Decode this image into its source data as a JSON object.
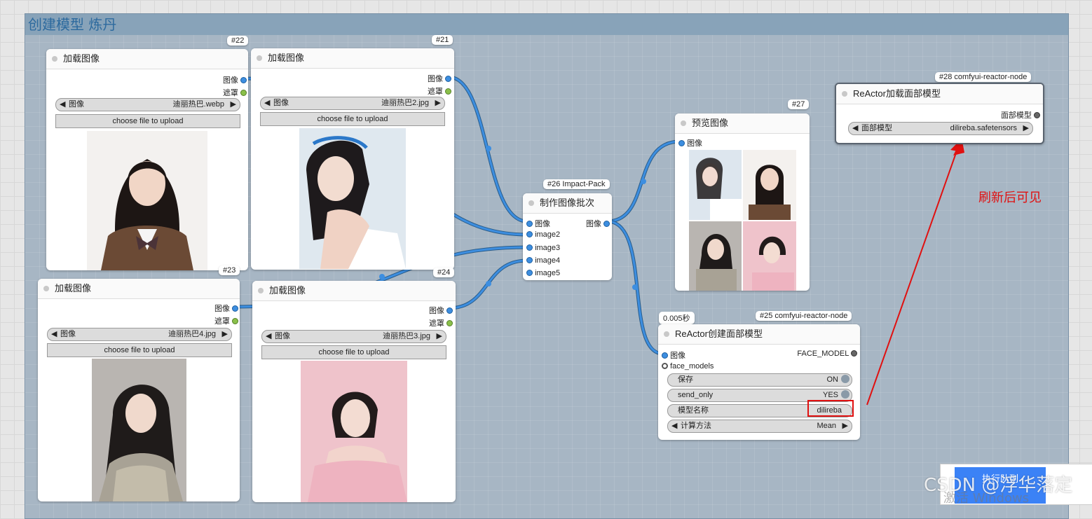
{
  "group": {
    "title": "创建模型  炼丹"
  },
  "load_nodes": [
    {
      "id": "#22",
      "title": "加载图像",
      "out_image": "图像",
      "out_mask": "遮罩",
      "combo_label": "图像",
      "combo_value": "迪丽热巴.webp",
      "upload": "choose file to upload"
    },
    {
      "id": "#21",
      "title": "加载图像",
      "out_image": "图像",
      "out_mask": "遮罩",
      "combo_label": "图像",
      "combo_value": "迪丽热巴2.jpg",
      "upload": "choose file to upload"
    },
    {
      "id": "#23",
      "title": "加载图像",
      "out_image": "图像",
      "out_mask": "遮罩",
      "combo_label": "图像",
      "combo_value": "迪丽热巴4.jpg",
      "upload": "choose file to upload"
    },
    {
      "id": "#24",
      "title": "加载图像",
      "out_image": "图像",
      "out_mask": "遮罩",
      "combo_label": "图像",
      "combo_value": "迪丽热巴3.jpg",
      "upload": "choose file to upload"
    }
  ],
  "batch_node": {
    "id": "#26 Impact-Pack",
    "title": "制作图像批次",
    "inputs": [
      "图像",
      "image2",
      "image3",
      "image4",
      "image5"
    ],
    "output": "图像"
  },
  "preview_node": {
    "id": "#27",
    "title": "预览图像",
    "input": "图像"
  },
  "create_node": {
    "id": "#25 comfyui-reactor-node",
    "time": "0.005秒",
    "title": "ReActor创建面部模型",
    "input_image": "图像",
    "input_face_models": "face_models",
    "output": "FACE_MODEL",
    "save_label": "保存",
    "save_value": "ON",
    "send_only_label": "send_only",
    "send_only_value": "YES",
    "name_label": "模型名称",
    "name_value": "dilireba",
    "method_label": "计算方法",
    "method_value": "Mean"
  },
  "load_face_node": {
    "id": "#28 comfyui-reactor-node",
    "title": "ReActor加载面部模型",
    "output": "面部模型",
    "combo_label": "面部模型",
    "combo_value": "dilireba.safetensors"
  },
  "annotation": {
    "text": "刷新后可见"
  },
  "queue_button": {
    "label": "执行队列"
  },
  "watermark": {
    "csdn": "CSDN @浮华落定",
    "windows": "激活 Windows"
  },
  "colors": {
    "link": "#3d8ee0",
    "annotation": "#e01010",
    "group_bg": "#a7b6c4"
  }
}
